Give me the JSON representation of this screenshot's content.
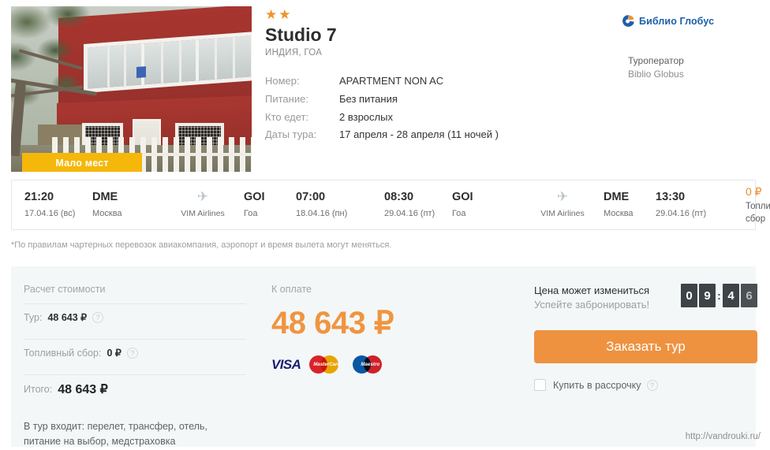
{
  "hotel": {
    "stars": "★★",
    "star_count": 2,
    "name": "Studio 7",
    "location": "ИНДИЯ, ГОА",
    "badge": "Мало мест",
    "specs": [
      {
        "key": "Номер:",
        "value": "APARTMENT NON AC"
      },
      {
        "key": "Питание:",
        "value": "Без питания"
      },
      {
        "key": "Кто едет:",
        "value": "2 взрослых"
      },
      {
        "key": "Даты тура:",
        "value": "17 апреля - 28 апреля (11 ночей )"
      }
    ]
  },
  "operator": {
    "logo_text": "Библио Глобус",
    "label": "Туроператор",
    "name": "Biblio Globus"
  },
  "flights": {
    "outbound": {
      "depart_time": "21:20",
      "depart_date": "17.04.16 (вс)",
      "depart_code": "DME",
      "depart_city": "Москва",
      "airline": "VIM Airlines",
      "arrive_code": "GOI",
      "arrive_city": "Гоа",
      "arrive_time": "07:00",
      "arrive_date": "18.04.16 (пн)"
    },
    "inbound": {
      "depart_time": "08:30",
      "depart_date": "29.04.16 (пт)",
      "depart_code": "GOI",
      "depart_city": "Гоа",
      "airline": "VIM Airlines",
      "arrive_code": "DME",
      "arrive_city": "Москва",
      "arrive_time": "13:30",
      "arrive_date": "29.04.16 (пт)"
    },
    "fuel": {
      "amount": "0 ₽",
      "label": "Топливный сбор"
    }
  },
  "disclaimer": "*По правилам чартерных перевозок авиакомпания, аэропорт и время вылета могут меняться.",
  "calc": {
    "title": "Расчет стоимости",
    "rows": [
      {
        "label": "Тур:",
        "value": "48 643 ₽",
        "info": "?"
      },
      {
        "label": "Топливный сбор:",
        "value": "0 ₽",
        "info": "?"
      }
    ],
    "total_label": "Итого:",
    "total_value": "48 643 ₽",
    "includes": "В тур входит: перелет, трансфер, отель, питание на выбор, медстраховка"
  },
  "payment": {
    "title": "К оплате",
    "price": "48 643 ₽",
    "cards": [
      {
        "name": "VISA"
      },
      {
        "name": "MasterCard"
      },
      {
        "name": "Maestro"
      }
    ]
  },
  "cta": {
    "notice_line1": "Цена может измениться",
    "notice_line2": "Успейте забронировать!",
    "countdown": {
      "d1": "0",
      "d2": "9",
      "sep": ":",
      "d3": "4",
      "d4": "6"
    },
    "button_label": "Заказать тур",
    "installment_label": "Купить в рассрочку",
    "installment_info": "?",
    "installment_checked": false
  },
  "watermark": "http://vandrouki.ru/",
  "colors": {
    "accent_orange": "#ee9240",
    "price_orange": "#ef9540",
    "badge_yellow": "#f5b70a",
    "panel_bg": "#f4f7f8",
    "brand_blue": "#1d5fa8",
    "clock_dark": "#3d4346"
  }
}
